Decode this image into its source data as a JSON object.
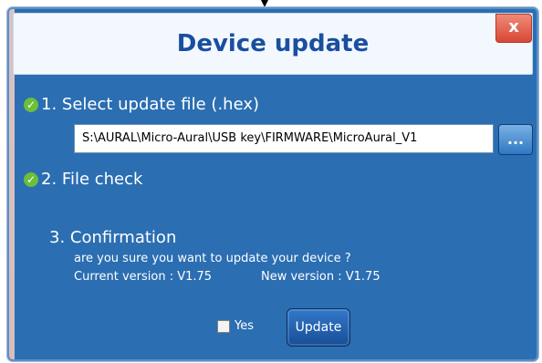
{
  "dialog": {
    "title": "Device update",
    "close_label": "x",
    "steps": {
      "select_file_label": "1. Select update file (.hex)",
      "file_check_label": "2. File check",
      "confirmation_label": "3. Confirmation"
    },
    "file_path_value": "S:\\AURAL\\Micro-Aural\\USB key\\FIRMWARE\\MicroAural_V1",
    "browse_button_label": "...",
    "confirmation_question": "are you sure you want to update your device ?",
    "current_version_label": "Current version : V1.75",
    "new_version_label": "New version : V1.75",
    "yes_label": "Yes",
    "update_button_label": "Update"
  },
  "colors": {
    "window_bg": "#2b6eb2",
    "header_bg": "#f3f8ff",
    "title_color": "#1a4fa0",
    "close_bg": "#d84735",
    "check_green": "#6bbf3a",
    "button_blue": "#2f78c3"
  },
  "icons": {
    "check": "check-icon",
    "close": "close-icon",
    "browse": "browse-icon"
  }
}
